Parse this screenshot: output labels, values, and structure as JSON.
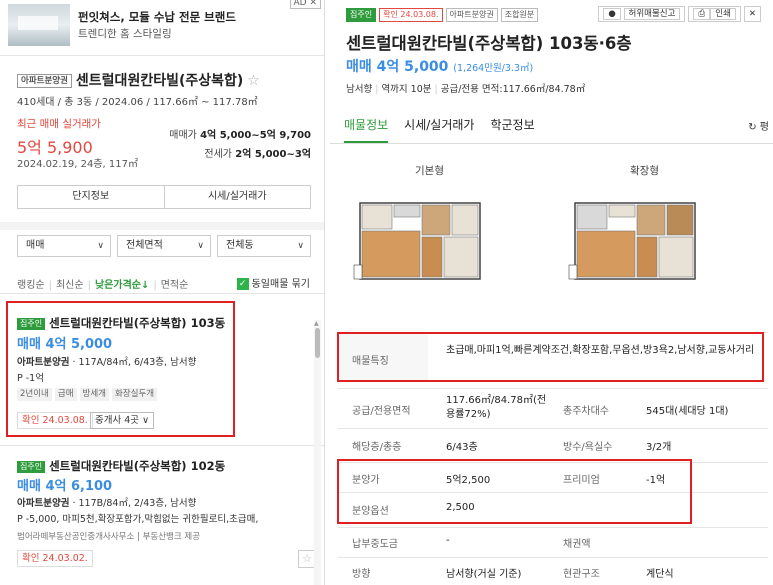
{
  "ad": {
    "title": "펀잇쳐스, 모듈 수납 전문 브랜드",
    "subtitle": "트렌디한 홈 스타일링",
    "badge": "AD ✕"
  },
  "complex": {
    "tag": "아파트분양권",
    "name": "센트럴대원칸타빌(주상복합)",
    "info": "410세대 / 총 3동 / 2024.06 / 117.66㎡ ~ 117.78㎡",
    "recent_label": "최근 매매 실거래가",
    "recent_price": "5억 5,900",
    "recent_date": "2024.02.19, 24층, 117㎡",
    "trade_label": "매매가",
    "trade_range": "4억 5,000~5억 9,700",
    "jeonse_label": "전세가",
    "jeonse_range": "2억 5,000~3억",
    "btn_info": "단지정보",
    "btn_price": "시세/실거래가"
  },
  "filters": {
    "f1": "매매",
    "f2": "전체면적",
    "f3": "전체동"
  },
  "sort": {
    "s1": "랭킹순",
    "s2": "최신순",
    "s3": "낮은가격순↓",
    "s4": "면적순",
    "same_label": "동일매물 묶기"
  },
  "listings": [
    {
      "tag": "집주인",
      "title": "센트럴대원칸타빌(주상복합) 103동",
      "price": "매매 4억 5,000",
      "type": "아파트분양권",
      "desc": " · 117A/84㎡, 6/43층, 남서향",
      "pp": "P -1억",
      "chips": [
        "2년이내",
        "급매",
        "방세개",
        "화장실두개"
      ],
      "confirm": "확인 24.03.08.",
      "agent": "중개사 4곳"
    },
    {
      "tag": "집주인",
      "title": "센트럴대원칸타빌(주상복합) 102동",
      "price": "매매 4억 6,100",
      "type": "아파트분양권",
      "desc": " · 117B/84㎡, 2/43층, 남서향",
      "pp": "P -5,000, 마피5천,확장포함가,막힘없는 귀한필로티,초급매,",
      "src": "범어라떼부동산공인중개사사무소 | 부동산뱅크 제공",
      "confirm": "확인 24.03.02."
    }
  ],
  "detail": {
    "tag_owner": "집주인",
    "tag_confirm": "확인 24.03.08.",
    "tag_type": "아파트분양권",
    "tag_union": "조합원분",
    "act_report": "허위매물신고",
    "act_print": "인쇄",
    "title": "센트럴대원칸타빌(주상복합) 103동·6층",
    "price": "매매 4억 5,000",
    "price_unit": "(1,264만원/3.3㎡)",
    "info1": "남서향",
    "info2": "역까지 10분",
    "info3": "공급/전용 면적:117.66㎡/84.78㎡",
    "tabs": [
      "매물정보",
      "시세/실거래가",
      "학군정보"
    ],
    "refresh": "평",
    "fp_basic": "기본형",
    "fp_ext": "확장형",
    "features_label": "매물특징",
    "features": "초급매,마피1억,빠른계약조건,확장포함,무옵션,방3욕2,남서향,교동사거리",
    "area_label": "공급/전용면적",
    "area": "117.66㎡/84.78㎡(전용률72%)",
    "households_label": "총주차대수",
    "households": "545대(세대당 1대)",
    "floor_label": "해당층/총층",
    "floor": "6/43층",
    "rooms_label": "방수/욕실수",
    "rooms": "3/2개",
    "sale_label": "분양가",
    "sale": "5억2,500",
    "premium_label": "프리미엄",
    "premium": "-1억",
    "option_label": "분양옵션",
    "option": "2,500",
    "tax_label": "납부중도금",
    "tax": "-",
    "bond_label": "채권액",
    "bond": "",
    "dir_label": "방향",
    "dir": "남서향(거실 기준)",
    "struct_label": "현관구조",
    "struct": "계단식"
  }
}
